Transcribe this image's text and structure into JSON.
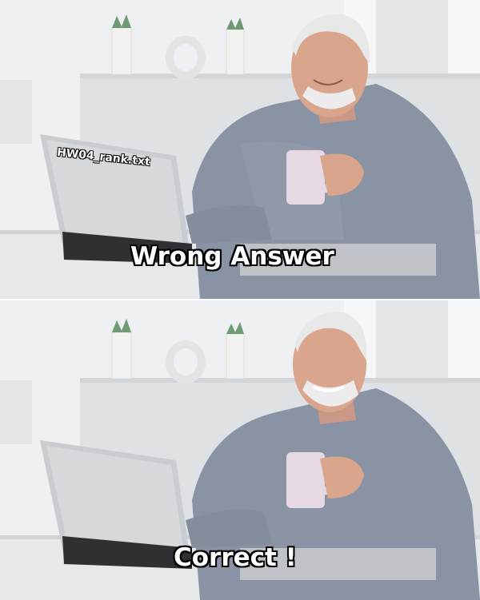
{
  "meme": {
    "file_label": "HW04_rank.txt",
    "top_caption": "Wrong Answer",
    "bottom_caption": "Correct !"
  },
  "colors": {
    "wall": "#eef0f2",
    "shelf": "#dfe2e5",
    "desk": "#e6e8ea",
    "shirt": "#8a93a3",
    "skin": "#d9a58c",
    "hair": "#e8e8e8",
    "laptop": "#c9ccd0",
    "mug": "#e7d9e3"
  }
}
